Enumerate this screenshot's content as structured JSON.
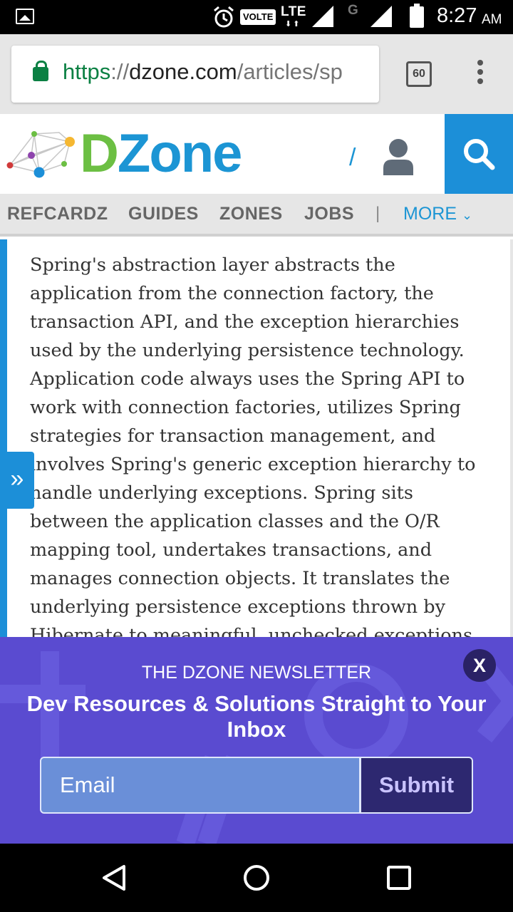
{
  "status_bar": {
    "volte": "VOLTE",
    "lte": "LTE",
    "network_g": "G",
    "time": "8:27",
    "ampm": "AM"
  },
  "browser": {
    "url_scheme": "https",
    "url_sep": "://",
    "url_host": "dzone.com",
    "url_path": "/articles/sp",
    "tabs_count": "60"
  },
  "site": {
    "logo_d": "D",
    "logo_zone": "Zone",
    "slash": "/",
    "brand_green": "#6cbf43",
    "brand_blue": "#1c95d4"
  },
  "nav": {
    "items": [
      "REFCARDZ",
      "GUIDES",
      "ZONES",
      "JOBS"
    ],
    "separator": "|",
    "more": "MORE"
  },
  "article": {
    "lines": [
      "Spring's abstraction layer abstracts the",
      "application from the connection factory, the",
      "transaction API, and the exception hierarchies",
      "used by the underlying persistence technology.",
      "Application code always uses the Spring API to",
      "work with connection factories, utilizes Spring",
      "strategies for transaction management, and",
      "involves Spring's generic exception hierarchy to",
      "handle underlying exceptions. Spring sits",
      "between the application classes and the O/R",
      "mapping tool, undertakes transactions, and",
      "manages connection objects. It translates the",
      "underlying persistence exceptions thrown by",
      "Hibernate to meaningful, unchecked exceptions"
    ]
  },
  "newsletter": {
    "close": "X",
    "kicker": "THE DZONE NEWSLETTER",
    "title": "Dev Resources & Solutions Straight to Your Inbox",
    "email_placeholder": "Email",
    "submit": "Submit"
  }
}
